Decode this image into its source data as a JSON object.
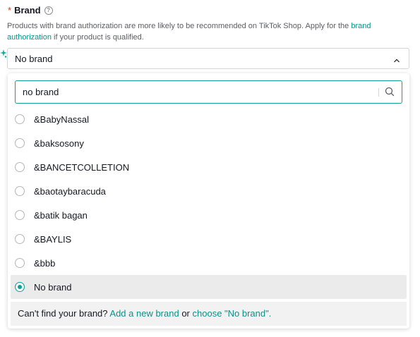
{
  "field": {
    "required_mark": "*",
    "label": "Brand",
    "help_icon": "question-circle-icon",
    "description_part1": "Products with brand authorization are more likely to be recommended on TikTok Shop. Apply for the ",
    "description_link": "brand authorization",
    "description_part2": " if your product is qualified."
  },
  "select": {
    "value": "No brand",
    "expanded": true,
    "chevron_icon": "chevron-up-icon"
  },
  "dropdown": {
    "search": {
      "value": "no brand",
      "icon": "search-icon"
    },
    "options": [
      {
        "label": "&BabyNassal",
        "selected": false
      },
      {
        "label": "&baksosony",
        "selected": false
      },
      {
        "label": "&BANCETCOLLETION",
        "selected": false
      },
      {
        "label": "&baotaybaracuda",
        "selected": false
      },
      {
        "label": "&batik bagan",
        "selected": false
      },
      {
        "label": "&BAYLIS",
        "selected": false
      },
      {
        "label": "&bbb",
        "selected": false
      },
      {
        "label": "No brand",
        "selected": true
      }
    ],
    "footer": {
      "prefix": "Can't find your brand? ",
      "add_link": "Add a new brand",
      "middle": " or ",
      "choose_link": "choose \"No brand\".",
      "suffix": ""
    }
  },
  "colors": {
    "accent": "#0f9e99",
    "link": "#0e8f8a",
    "required": "#e0322b",
    "selected_bg": "#ebebeb"
  }
}
